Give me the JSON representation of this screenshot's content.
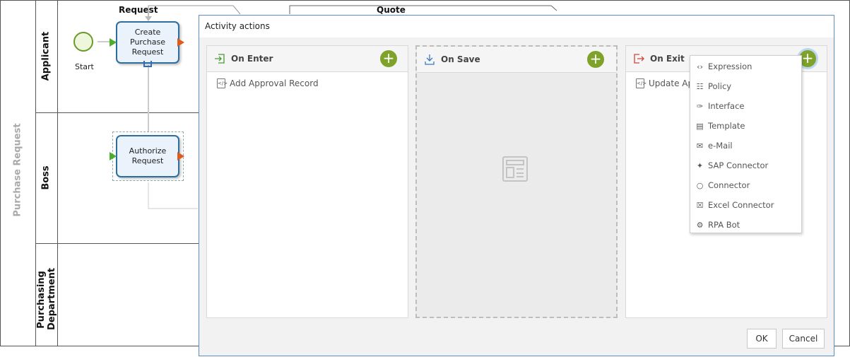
{
  "diagram": {
    "pool_name": "Purchase Request",
    "lanes": [
      "Applicant",
      "Boss",
      "Purchasing Department"
    ],
    "phases": [
      "Request",
      "Quote"
    ],
    "start_label": "Start",
    "tasks": [
      "Create Purchase Request",
      "Authorize Request"
    ]
  },
  "dialog": {
    "title": "Activity actions",
    "panels": [
      {
        "title": "On Enter",
        "items": [
          "Add Approval Record"
        ]
      },
      {
        "title": "On Save",
        "items": []
      },
      {
        "title": "On Exit",
        "items": [
          "Update App"
        ]
      }
    ],
    "ok_label": "OK",
    "cancel_label": "Cancel"
  },
  "add_menu": {
    "items": [
      {
        "label": "Expression",
        "icon": "expression-icon"
      },
      {
        "label": "Policy",
        "icon": "policy-icon"
      },
      {
        "label": "Interface",
        "icon": "interface-icon"
      },
      {
        "label": "Template",
        "icon": "template-icon"
      },
      {
        "label": "e-Mail",
        "icon": "email-icon"
      },
      {
        "label": "SAP Connector",
        "icon": "sap-connector-icon"
      },
      {
        "label": "Connector",
        "icon": "connector-icon"
      },
      {
        "label": "Excel Connector",
        "icon": "excel-icon"
      },
      {
        "label": "RPA Bot",
        "icon": "rpa-bot-icon"
      }
    ]
  },
  "colors": {
    "add_button": "#7ea22a",
    "task_border": "#2e6e9e",
    "modal_border": "#5a8fc5"
  }
}
